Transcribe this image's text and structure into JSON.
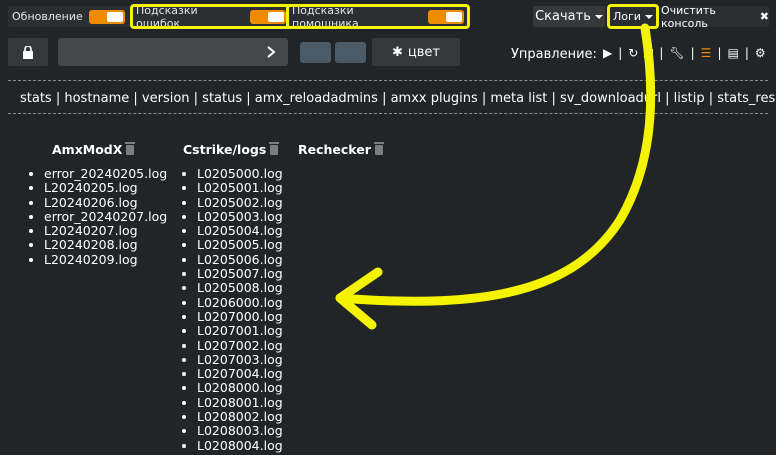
{
  "toggles": [
    {
      "label": "Обновление"
    },
    {
      "label": "Подсказки ошибок"
    },
    {
      "label": "Подсказки помошника"
    }
  ],
  "header_right": {
    "download_label": "Скачать",
    "logs_label": "Логи",
    "clear_label": "Очистить консоль"
  },
  "toolbar": {
    "color_label": "цвет",
    "control_label": "Управление:"
  },
  "commands": "stats | hostname | version | status | amx_reloadadmins | amxx plugins | meta list | sv_downloadurl | listip | stats_reset",
  "logs": {
    "amxmodx": {
      "title": "AmxModX",
      "files": [
        "error_20240205.log",
        "L20240205.log",
        "L20240206.log",
        "error_20240207.log",
        "L20240207.log",
        "L20240208.log",
        "L20240209.log"
      ]
    },
    "cstrike": {
      "title": "Cstrike/logs",
      "files": [
        "L0205000.log",
        "L0205001.log",
        "L0205002.log",
        "L0205003.log",
        "L0205004.log",
        "L0205005.log",
        "L0205006.log",
        "L0205007.log",
        "L0205008.log",
        "L0206000.log",
        "L0207000.log",
        "L0207001.log",
        "L0207002.log",
        "L0207003.log",
        "L0207004.log",
        "L0208000.log",
        "L0208001.log",
        "L0208002.log",
        "L0208003.log",
        "L0208004.log"
      ]
    },
    "rechecker": {
      "title": "Rechecker",
      "files": []
    }
  },
  "colors": {
    "accent": "#f08a00",
    "highlight": "#f4f400",
    "background": "#222527"
  },
  "icons": [
    "lock-icon",
    "chevron-right-icon",
    "gear-icon",
    "play-icon",
    "refresh-icon",
    "stop-icon",
    "wrench-icon",
    "list-icon",
    "page-icon",
    "settings-icon",
    "trash-icon",
    "close-icon",
    "arrow-annotation"
  ]
}
